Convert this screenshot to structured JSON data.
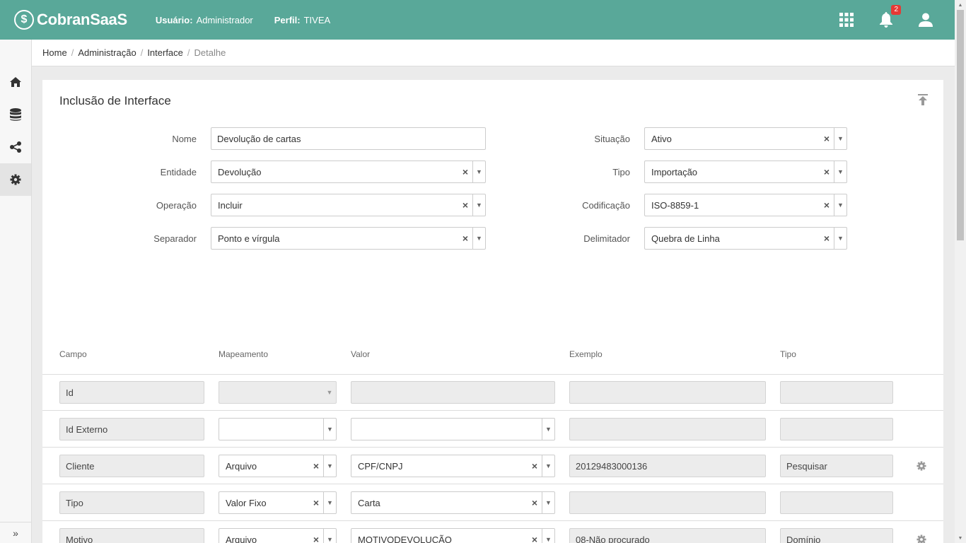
{
  "header": {
    "app_name": "CobranSaaS",
    "user_label": "Usuário:",
    "user_value": "Administrador",
    "profile_label": "Perfil:",
    "profile_value": "TIVEA",
    "notification_count": "2",
    "brand_color": "#59a899"
  },
  "sidebar": {
    "items": [
      {
        "icon": "home-icon"
      },
      {
        "icon": "database-icon"
      },
      {
        "icon": "share-icon"
      },
      {
        "icon": "gear-icon"
      }
    ],
    "expand_glyph": "»"
  },
  "breadcrumb": {
    "items": [
      "Home",
      "Administração",
      "Interface"
    ],
    "current": "Detalhe"
  },
  "form": {
    "title": "Inclusão de Interface",
    "nome": {
      "label": "Nome",
      "value": "Devolução de cartas"
    },
    "entidade": {
      "label": "Entidade",
      "value": "Devolução"
    },
    "operacao": {
      "label": "Operação",
      "value": "Incluir"
    },
    "separador": {
      "label": "Separador",
      "value": "Ponto e vírgula"
    },
    "situacao": {
      "label": "Situação",
      "value": "Ativo"
    },
    "tipo": {
      "label": "Tipo",
      "value": "Importação"
    },
    "codificacao": {
      "label": "Codificação",
      "value": "ISO-8859-1"
    },
    "delimitador": {
      "label": "Delimitador",
      "value": "Quebra de Linha"
    }
  },
  "table": {
    "columns": [
      "Campo",
      "Mapeamento",
      "Valor",
      "Exemplo",
      "Tipo"
    ],
    "rows": [
      {
        "campo": "Id",
        "mapeamento": "",
        "valor": "",
        "exemplo": "",
        "tipo": ""
      },
      {
        "campo": "Id Externo",
        "mapeamento": "",
        "valor": "",
        "exemplo": "",
        "tipo": ""
      },
      {
        "campo": "Cliente",
        "mapeamento": "Arquivo",
        "valor": "CPF/CNPJ",
        "exemplo": "20129483000136",
        "tipo": "Pesquisar"
      },
      {
        "campo": "Tipo",
        "mapeamento": "Valor Fixo",
        "valor": "Carta",
        "exemplo": "",
        "tipo": ""
      },
      {
        "campo": "Motivo",
        "mapeamento": "Arquivo",
        "valor": "MOTIVODEVOLUÇÃO",
        "exemplo": "08-Não procurado",
        "tipo": "Domínio"
      }
    ]
  },
  "icons": {
    "clear": "×",
    "dropdown": "▼"
  }
}
